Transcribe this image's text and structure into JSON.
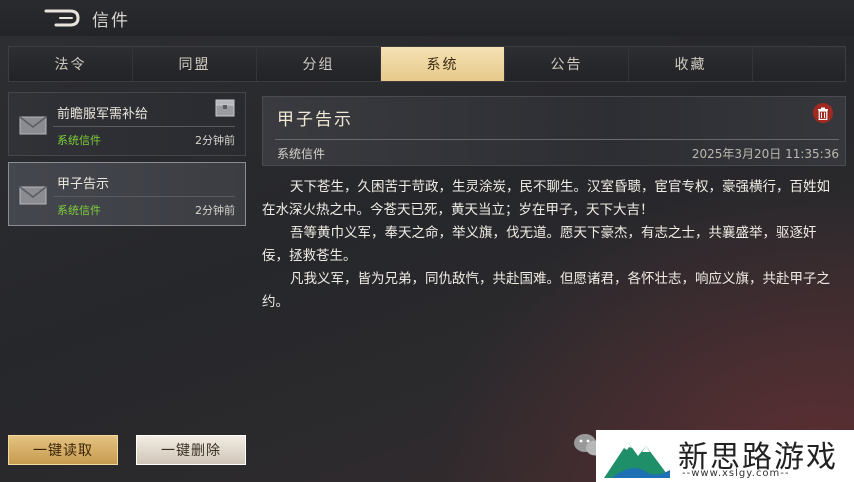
{
  "header": {
    "title": "信件"
  },
  "tabs": [
    {
      "label": "法令"
    },
    {
      "label": "同盟"
    },
    {
      "label": "分组"
    },
    {
      "label": "系统",
      "active": true
    },
    {
      "label": "公告"
    },
    {
      "label": "收藏"
    }
  ],
  "mail_list": [
    {
      "title": "前瞻服军需补给",
      "type": "系统信件",
      "time": "2分钟前",
      "icon": "envelope-icon",
      "attachment_icon": "reward-chest-icon"
    },
    {
      "title": "甲子告示",
      "type": "系统信件",
      "time": "2分钟前",
      "icon": "envelope-icon",
      "selected": true
    }
  ],
  "buttons": {
    "read_all": "一键读取",
    "delete_all": "一键删除"
  },
  "detail": {
    "title": "甲子告示",
    "type": "系统信件",
    "date": "2025年3月20日 11:35:36",
    "paragraphs": [
      "天下苍生，久困苦于苛政，生灵涂炭，民不聊生。汉室昏聩，宦官专权，豪强横行，百姓如在水深火热之中。今苍天已死，黄天当立；岁在甲子，天下大吉！",
      "吾等黄巾义军，奉天之命，举义旗，伐无道。愿天下豪杰，有志之士，共襄盛举，驱逐奸佞，拯救苍生。",
      "凡我义军，皆为兄弟，同仇敌忾，共赴国难。但愿诸君，各怀壮志，响应义旗，共赴甲子之约。"
    ]
  },
  "watermark": {
    "name": "新思路游戏",
    "url": "--www.xslgy.com--"
  },
  "colors": {
    "accent": "#e7c98a",
    "green": "#7fcf3a",
    "delete_red": "#a02a22"
  }
}
